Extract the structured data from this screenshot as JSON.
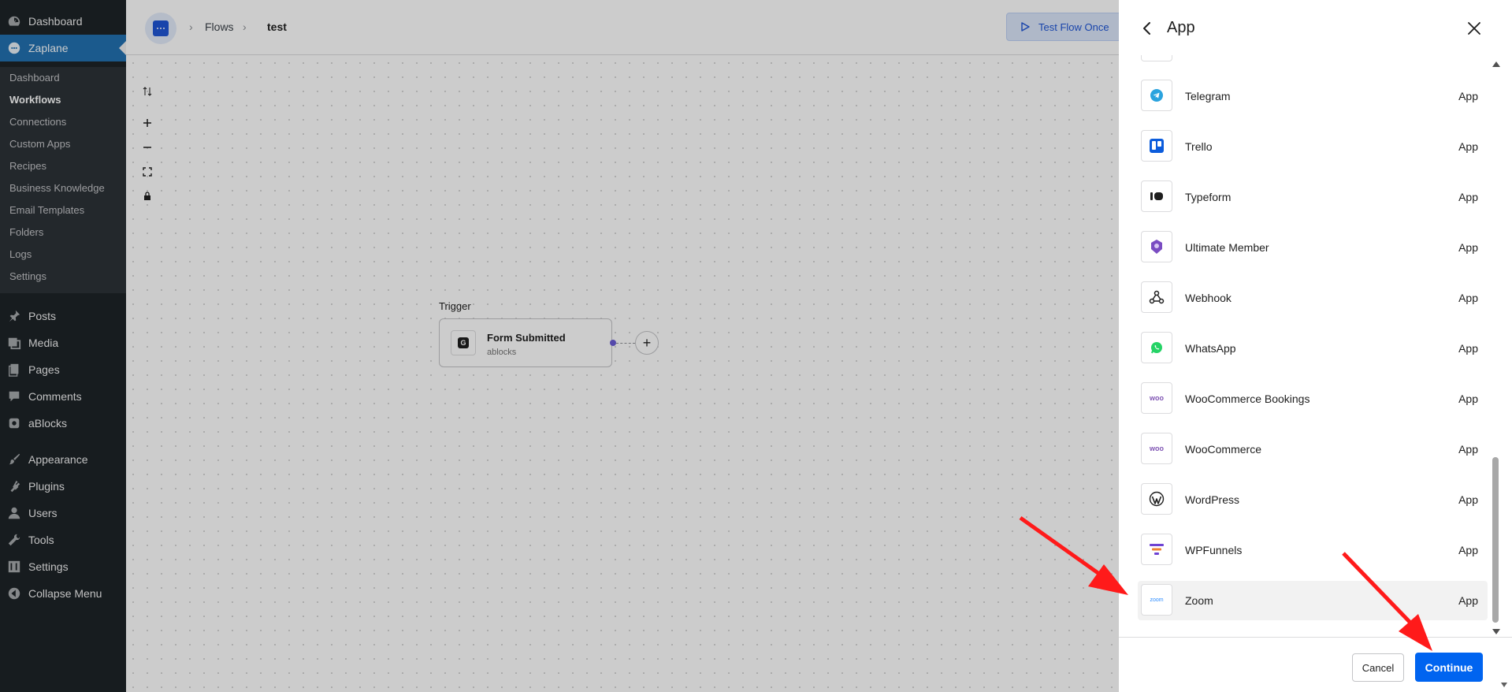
{
  "wp_menu": {
    "dashboard": "Dashboard",
    "zaplane": "Zaplane",
    "submenu": [
      "Dashboard",
      "Workflows",
      "Connections",
      "Custom Apps",
      "Recipes",
      "Business Knowledge",
      "Email Templates",
      "Folders",
      "Logs",
      "Settings"
    ],
    "posts": "Posts",
    "media": "Media",
    "pages": "Pages",
    "comments": "Comments",
    "ablocks": "aBlocks",
    "appearance": "Appearance",
    "plugins": "Plugins",
    "users": "Users",
    "tools": "Tools",
    "settings": "Settings",
    "collapse": "Collapse Menu"
  },
  "breadcrumb": {
    "flows": "Flows",
    "current": "test"
  },
  "toolbar": {
    "test_flow": "Test Flow Once"
  },
  "canvas": {
    "trigger_label": "Trigger",
    "node_title": "Form Submitted",
    "node_subtitle": "ablocks"
  },
  "panel": {
    "title": "App",
    "apps": [
      {
        "name": "Telegram",
        "type": "App",
        "icon": "telegram-logo"
      },
      {
        "name": "Trello",
        "type": "App",
        "icon": "trello-logo"
      },
      {
        "name": "Typeform",
        "type": "App",
        "icon": "typeform-logo"
      },
      {
        "name": "Ultimate Member",
        "type": "App",
        "icon": "ultimate-member-logo"
      },
      {
        "name": "Webhook",
        "type": "App",
        "icon": "webhook-logo"
      },
      {
        "name": "WhatsApp",
        "type": "App",
        "icon": "whatsapp-logo"
      },
      {
        "name": "WooCommerce Bookings",
        "type": "App",
        "icon": "woo-logo"
      },
      {
        "name": "WooCommerce",
        "type": "App",
        "icon": "woo-logo"
      },
      {
        "name": "WordPress",
        "type": "App",
        "icon": "wordpress-logo"
      },
      {
        "name": "WPFunnels",
        "type": "App",
        "icon": "wpfunnels-logo"
      },
      {
        "name": "Zoom",
        "type": "App",
        "icon": "zoom-logo",
        "selected": true
      }
    ],
    "woo_logo_text": "woo",
    "zoom_logo_text": "zoom",
    "cancel": "Cancel",
    "continue": "Continue"
  },
  "colors": {
    "wp_sidebar": "#1d2327",
    "wp_accent": "#2271b1",
    "primary_button": "#0064f0",
    "annotation_arrow": "#ff1a1a"
  }
}
